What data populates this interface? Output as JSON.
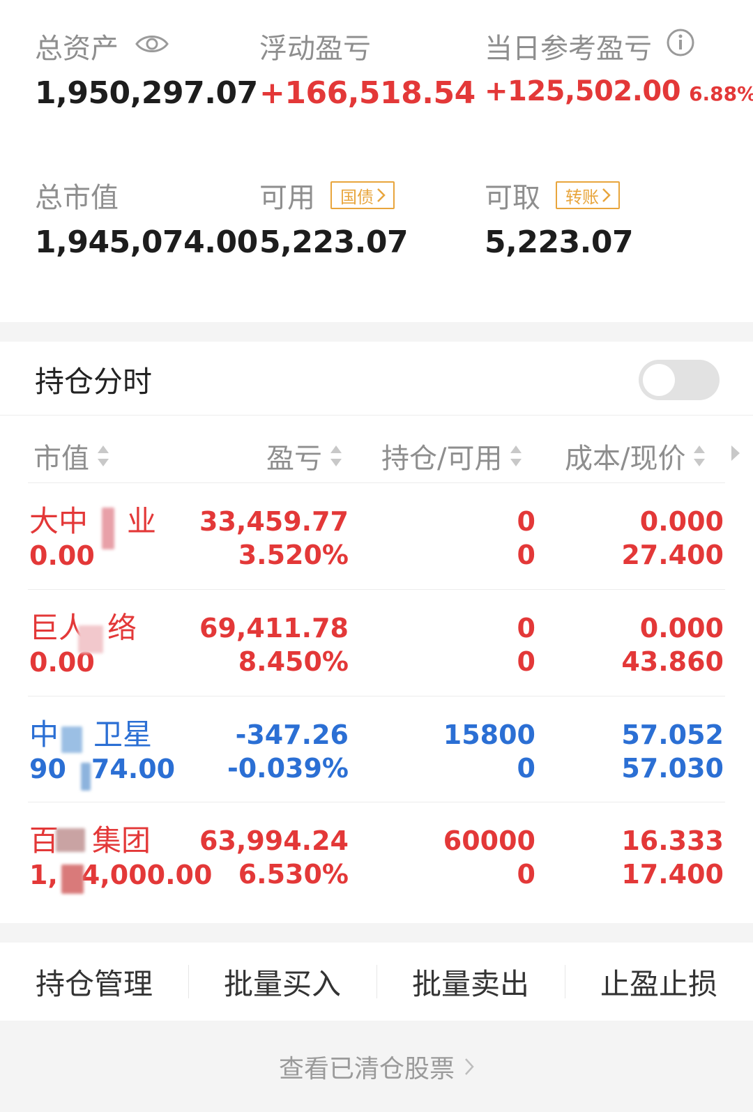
{
  "summary": {
    "total_assets": {
      "label": "总资产",
      "value": "1,950,297.07"
    },
    "floating_pl": {
      "label": "浮动盈亏",
      "value": "+166,518.54"
    },
    "daily_pl": {
      "label": "当日参考盈亏",
      "value": "+125,502.00",
      "percent": "6.88%"
    },
    "market_value": {
      "label": "总市值",
      "value": "1,945,074.00"
    },
    "available": {
      "label": "可用",
      "value": "5,223.07",
      "tag": "国债"
    },
    "withdrawable": {
      "label": "可取",
      "value": "5,223.07",
      "tag": "转账"
    }
  },
  "intraday": {
    "label": "持仓分时",
    "enabled": false
  },
  "table": {
    "headers": {
      "market_value": "市值",
      "pl": "盈亏",
      "hold": "持仓/可用",
      "cost": "成本/现价"
    },
    "rows": [
      {
        "name_a": "大中",
        "name_b": "业",
        "market_value": "0.00",
        "pl": "33,459.77",
        "pl_pct": "3.520%",
        "hold": "0",
        "avail": "0",
        "cost": "0.000",
        "price": "27.400",
        "color": "red"
      },
      {
        "name_a": "巨人",
        "name_b": "络",
        "market_value": "0.00",
        "pl": "69,411.78",
        "pl_pct": "8.450%",
        "hold": "0",
        "avail": "0",
        "cost": "0.000",
        "price": "43.860",
        "color": "red"
      },
      {
        "name_a": "中",
        "name_b": "卫星",
        "market_value_a": "90",
        "market_value_b": "74.00",
        "pl": "-347.26",
        "pl_pct": "-0.039%",
        "hold": "15800",
        "avail": "0",
        "cost": "57.052",
        "price": "57.030",
        "color": "blue"
      },
      {
        "name_a": "百",
        "name_b": "集团",
        "market_value_a": "1,",
        "market_value_b": "4,000.00",
        "pl": "63,994.24",
        "pl_pct": "6.530%",
        "hold": "60000",
        "avail": "0",
        "cost": "16.333",
        "price": "17.400",
        "color": "red"
      }
    ]
  },
  "actions": [
    "持仓管理",
    "批量买入",
    "批量卖出",
    "止盈止损"
  ],
  "footer": {
    "label": "查看已清仓股票"
  },
  "colors": {
    "up": "#e33838",
    "down": "#2b6fd4",
    "tag": "#e8a53c",
    "label": "#8e8e8e"
  }
}
